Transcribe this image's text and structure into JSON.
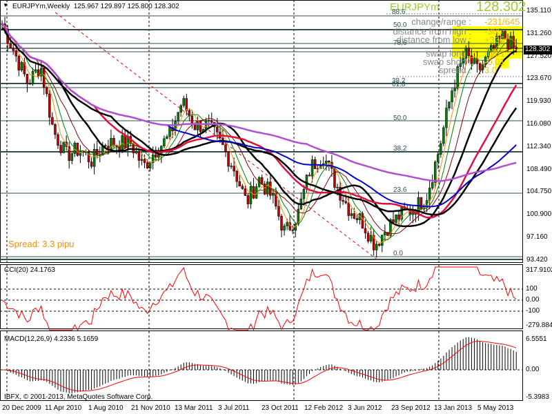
{
  "header": {
    "symbol_period": "EURJPYm,Weekly",
    "ohlc": "125.967 129.897 125.800 128.302"
  },
  "info": {
    "symbol": "EURJPYm",
    "price": "128.302",
    "rows": [
      {
        "label": "change/range",
        "sep": ":",
        "value": "-231/645"
      },
      {
        "label": "distance from high",
        "sep": ":",
        "value": "-365"
      },
      {
        "label": "distance from low",
        "sep": ":",
        "value": "+335"
      },
      {
        "label": "swap long",
        "sep": ":",
        "value": "-0.01"
      },
      {
        "label": "swap short",
        "sep": ":",
        "value": "-0.01"
      },
      {
        "label": "spread",
        "sep": ":",
        "value": "3.0"
      }
    ]
  },
  "spread_text": "Spread: 3.3 pipu",
  "fib_levels": [
    "88.6",
    "50.0",
    "78.6",
    "38.2",
    "61.8",
    "50.0",
    "38.2",
    "23.6",
    "0.0"
  ],
  "price_axis": [
    "135.110",
    "131.260",
    "127.520",
    "123.670",
    "119.930",
    "116.080",
    "112.340",
    "108.490",
    "104.750",
    "100.900",
    "97.160",
    "93.420"
  ],
  "current_price": "128.302",
  "cci": {
    "title": "CCI(20) 24.1763",
    "axis": [
      "317.9102",
      "100",
      "0.00",
      "-100",
      "-279.8847"
    ]
  },
  "macd": {
    "title": "MACD(12,26,9) 4.2336 5.1659",
    "axis": [
      "6.5551",
      "0.00",
      "-5.3983"
    ]
  },
  "copyright": "IBFX, © 2001-2013, MetaQuotes Software Corp.",
  "time_axis": [
    "20 Dec 2009",
    "11 Apr 2010",
    "1 Aug 2010",
    "21 Nov 2010",
    "13 Mar 2011",
    "3 Jul 2011",
    "23 Oct 2011",
    "12 Feb 2012",
    "3 Jun 2012",
    "23 Sep 2012",
    "13 Jan 2013",
    "5 May 2013"
  ],
  "colors": {
    "bull": "#008000",
    "bear": "#c00000",
    "ma_blue": "#0000cc",
    "ma_purple": "#b050d0",
    "ma_red": "#e0103c",
    "ma_black": "#000000",
    "cci": "#ff0000",
    "macd_hist": "#000000",
    "macd_signal": "#ff0000",
    "info_value": "#e8c000",
    "info_highlight": "#ffff00"
  },
  "chart_data": {
    "type": "candlestick",
    "weekly_close_samples": [
      133,
      128,
      123,
      126,
      115,
      111,
      112,
      110,
      113,
      113,
      113,
      109,
      112,
      114,
      120,
      116,
      116,
      113,
      109,
      103,
      107,
      104,
      98,
      101,
      109,
      111,
      106,
      102,
      100,
      96,
      99,
      101,
      102,
      104,
      112,
      122,
      128,
      125,
      128,
      131,
      128.3
    ],
    "ylim": [
      93.42,
      135.11
    ]
  }
}
